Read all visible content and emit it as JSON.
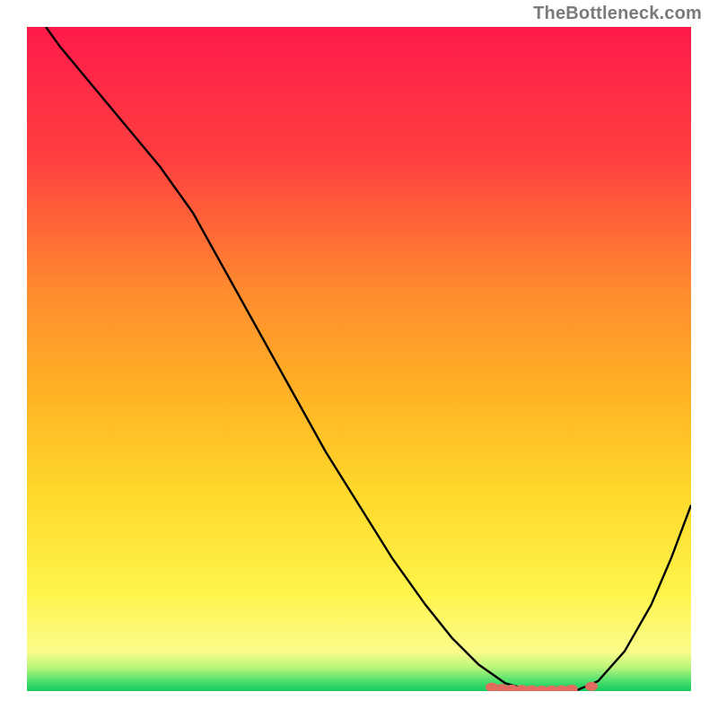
{
  "watermark": "TheBottleneck.com",
  "chart_data": {
    "type": "line",
    "title": "",
    "xlabel": "",
    "ylabel": "",
    "xlim": [
      0,
      100
    ],
    "ylim": [
      0,
      100
    ],
    "grid": false,
    "series": [
      {
        "name": "curve",
        "x": [
          0,
          5,
          10,
          15,
          20,
          25,
          30,
          35,
          40,
          45,
          50,
          55,
          60,
          64,
          68,
          72,
          75,
          78,
          80,
          83,
          86,
          90,
          94,
          97,
          100
        ],
        "y": [
          104,
          97,
          91,
          85,
          79,
          72,
          63,
          54,
          45,
          36,
          28,
          20,
          13,
          8,
          4,
          1.2,
          0.3,
          0.0,
          0.0,
          0.2,
          1.5,
          6,
          13,
          20,
          28
        ]
      }
    ],
    "markers": [
      {
        "x": 70,
        "y": 0.6
      },
      {
        "x": 71.5,
        "y": 0.4
      },
      {
        "x": 73,
        "y": 0.3
      },
      {
        "x": 74.5,
        "y": 0.25
      },
      {
        "x": 76,
        "y": 0.2
      },
      {
        "x": 77.5,
        "y": 0.15
      },
      {
        "x": 79,
        "y": 0.18
      },
      {
        "x": 80.5,
        "y": 0.2
      },
      {
        "x": 82,
        "y": 0.3
      },
      {
        "x": 85,
        "y": 0.7
      }
    ],
    "gradient_stops": [
      {
        "offset": 0.0,
        "color": "#ff1a4a"
      },
      {
        "offset": 0.2,
        "color": "#ff4040"
      },
      {
        "offset": 0.4,
        "color": "#ff8c2e"
      },
      {
        "offset": 0.55,
        "color": "#ffb225"
      },
      {
        "offset": 0.7,
        "color": "#ffd82a"
      },
      {
        "offset": 0.85,
        "color": "#fff44a"
      },
      {
        "offset": 0.94,
        "color": "#fbfc8a"
      },
      {
        "offset": 0.965,
        "color": "#b8f57a"
      },
      {
        "offset": 0.985,
        "color": "#4be06e"
      },
      {
        "offset": 1.0,
        "color": "#14c95e"
      }
    ],
    "marker_color": "#e26b60",
    "curve_color": "#000000"
  }
}
